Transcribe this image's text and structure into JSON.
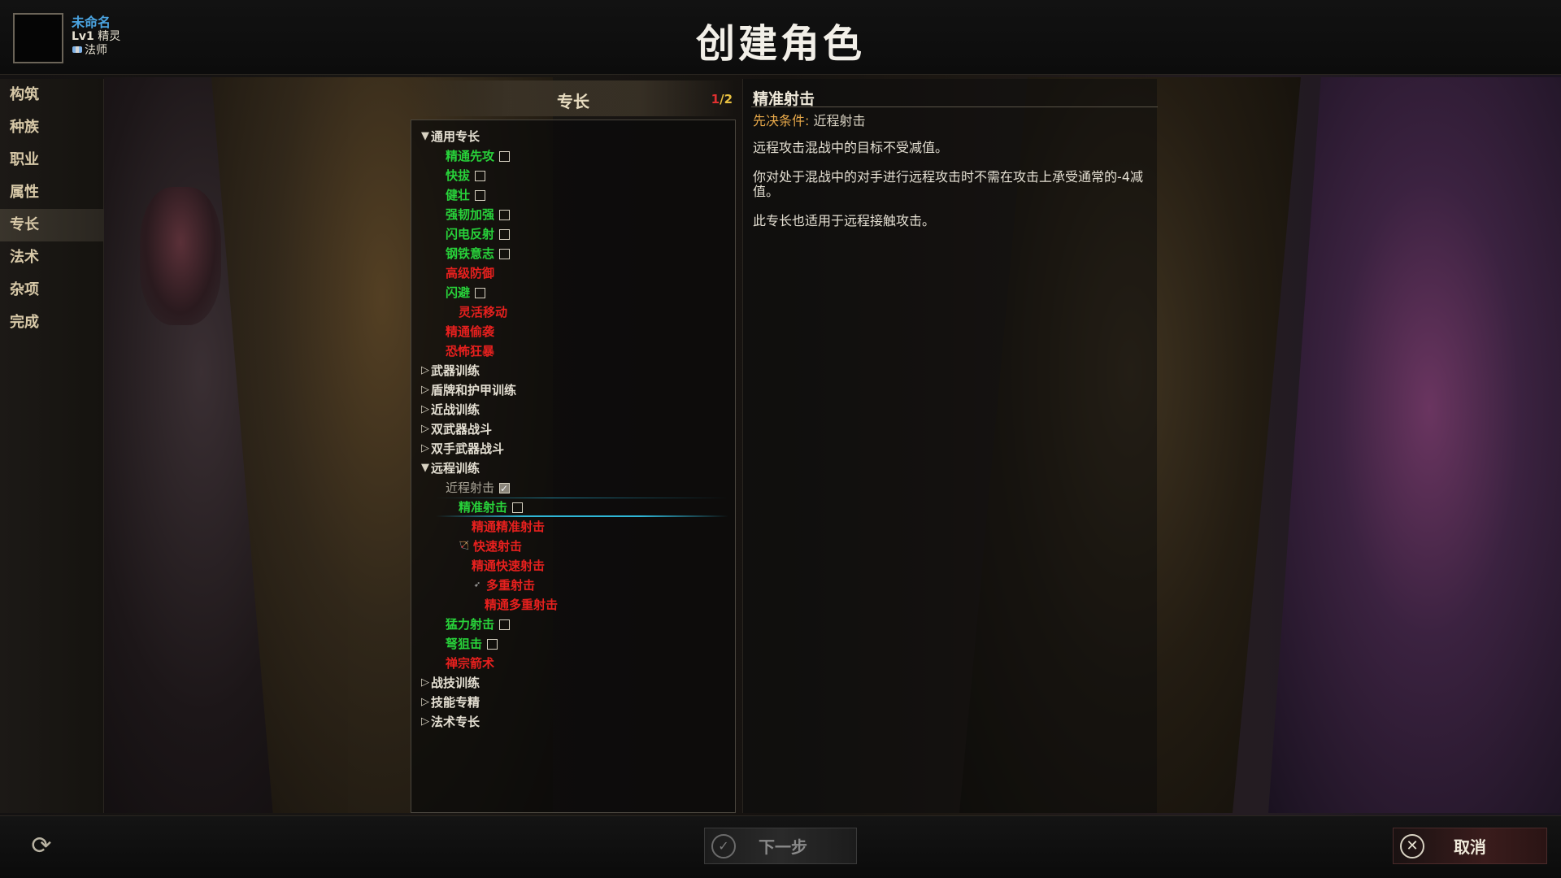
{
  "header": {
    "title": "创建角色",
    "character": {
      "name": "未命名",
      "level": "Lv1",
      "race": "精灵",
      "class": "法师",
      "class_icon": "wizard-class-icon"
    }
  },
  "sidebar": {
    "items": [
      {
        "label": "构筑",
        "active": false
      },
      {
        "label": "种族",
        "active": false
      },
      {
        "label": "职业",
        "active": false
      },
      {
        "label": "属性",
        "active": false
      },
      {
        "label": "专长",
        "active": true
      },
      {
        "label": "法术",
        "active": false
      },
      {
        "label": "杂项",
        "active": false
      },
      {
        "label": "完成",
        "active": false
      }
    ]
  },
  "feats": {
    "title": "专长",
    "count_used": "1",
    "count_separator": "/",
    "count_total": "2",
    "colors": {
      "available": "#28d23a",
      "unavailable": "#e6201e",
      "owned": "#a8a396",
      "category": "#e4dfd2",
      "highlight": "#2fb6d6"
    },
    "rows": [
      {
        "label": "通用专长",
        "arrow": "▼",
        "indent": 0,
        "color": "white"
      },
      {
        "label": "精通先攻",
        "indent": 2,
        "color": "green",
        "checkbox": "empty"
      },
      {
        "label": "快拔",
        "indent": 2,
        "color": "green",
        "checkbox": "empty"
      },
      {
        "label": "健壮",
        "indent": 2,
        "color": "green",
        "checkbox": "empty"
      },
      {
        "label": "强韧加强",
        "indent": 2,
        "color": "green",
        "checkbox": "empty"
      },
      {
        "label": "闪电反射",
        "indent": 2,
        "color": "green",
        "checkbox": "empty"
      },
      {
        "label": "钢铁意志",
        "indent": 2,
        "color": "green",
        "checkbox": "empty"
      },
      {
        "label": "高级防御",
        "indent": 2,
        "color": "red"
      },
      {
        "label": "闪避",
        "indent": 2,
        "color": "green",
        "checkbox": "empty"
      },
      {
        "label": "灵活移动",
        "indent": 3,
        "color": "red"
      },
      {
        "label": "精通偷袭",
        "indent": 2,
        "color": "red"
      },
      {
        "label": "恐怖狂暴",
        "indent": 2,
        "color": "red"
      },
      {
        "label": "武器训练",
        "arrow": "▷",
        "indent": 0,
        "color": "white"
      },
      {
        "label": "盾牌和护甲训练",
        "arrow": "▷",
        "indent": 0,
        "color": "white"
      },
      {
        "label": "近战训练",
        "arrow": "▷",
        "indent": 0,
        "color": "white"
      },
      {
        "label": "双武器战斗",
        "arrow": "▷",
        "indent": 0,
        "color": "white"
      },
      {
        "label": "双手武器战斗",
        "arrow": "▷",
        "indent": 0,
        "color": "white"
      },
      {
        "label": "远程训练",
        "arrow": "▼",
        "indent": 0,
        "color": "white"
      },
      {
        "label": "近程射击",
        "indent": 2,
        "color": "gray",
        "checkbox": "checked"
      },
      {
        "label": "精准射击",
        "indent": 3,
        "color": "green",
        "checkbox": "empty",
        "selected": true
      },
      {
        "label": "精通精准射击",
        "indent": 4,
        "color": "red"
      },
      {
        "label": "快速射击",
        "indent": 3,
        "color": "red",
        "icon": "bow-icon"
      },
      {
        "label": "精通快速射击",
        "indent": 4,
        "color": "red"
      },
      {
        "label": "多重射击",
        "indent": 4,
        "color": "red",
        "icon": "arrows-icon"
      },
      {
        "label": "精通多重射击",
        "indent": 5,
        "color": "red"
      },
      {
        "label": "猛力射击",
        "indent": 2,
        "color": "green",
        "checkbox": "empty"
      },
      {
        "label": "弩狙击",
        "indent": 2,
        "color": "green",
        "checkbox": "empty"
      },
      {
        "label": "禅宗箭术",
        "indent": 2,
        "color": "red"
      },
      {
        "label": "战技训练",
        "arrow": "▷",
        "indent": 0,
        "color": "white"
      },
      {
        "label": "技能专精",
        "arrow": "▷",
        "indent": 0,
        "color": "white"
      },
      {
        "label": "法术专长",
        "arrow": "▷",
        "indent": 0,
        "color": "white"
      }
    ]
  },
  "description": {
    "title": "精准射击",
    "prereq_label": "先决条件:",
    "prereq_value": " 近程射击",
    "paragraphs": [
      "远程攻击混战中的目标不受减值。",
      "你对处于混战中的对手进行远程攻击时不需在攻击上承受通常的-4减值。",
      "此专长也适用于远程接触攻击。"
    ]
  },
  "footer": {
    "refresh_icon": "refresh-icon",
    "next_label": "下一步",
    "next_icon": "check-circle-icon",
    "cancel_label": "取消",
    "cancel_icon": "close-circle-icon"
  }
}
